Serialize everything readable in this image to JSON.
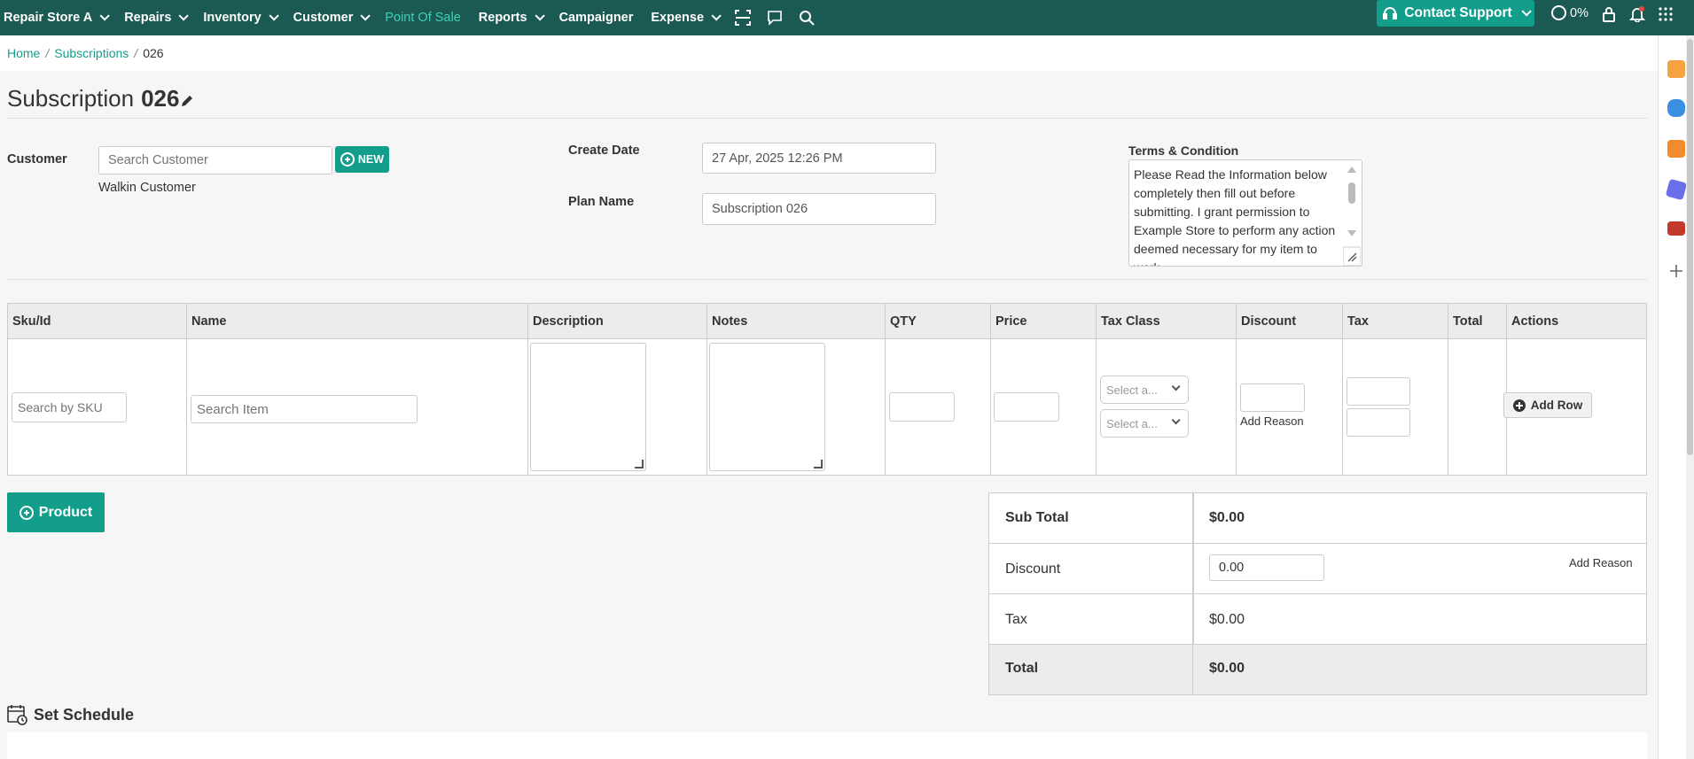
{
  "nav": {
    "store": "Repair Store A",
    "items": [
      "Repairs",
      "Inventory",
      "Customer"
    ],
    "pos": "Point Of Sale",
    "items2": [
      "Reports"
    ],
    "campaigner": "Campaigner",
    "expense": "Expense",
    "support": "Contact Support",
    "progress": "0%"
  },
  "breadcrumb": {
    "home": "Home",
    "subscriptions": "Subscriptions",
    "current": "026"
  },
  "page": {
    "title": "Subscription",
    "number": "026"
  },
  "form": {
    "customer_label": "Customer",
    "customer_placeholder": "Search Customer",
    "new_label": "NEW",
    "customer_value": "Walkin Customer",
    "create_date_label": "Create Date",
    "create_date_value": "27 Apr,  2025 12:26 PM",
    "plan_name_label": "Plan Name",
    "plan_name_value": "Subscription 026",
    "terms_label": "Terms & Condition",
    "terms_text": "Please Read the Information below completely then fill out before submitting. I grant permission to Example Store to perform any action deemed necessary for my item to work"
  },
  "table": {
    "headers": [
      "Sku/Id",
      "Name",
      "Description",
      "Notes",
      "QTY",
      "Price",
      "Tax Class",
      "Discount",
      "Tax",
      "Total",
      "Actions"
    ],
    "sku_placeholder": "Search by SKU",
    "item_placeholder": "Search Item",
    "select_placeholder": "Select a...",
    "add_reason": "Add Reason",
    "add_row": "Add Row"
  },
  "product_btn": "Product",
  "totals": {
    "subtotal_label": "Sub Total",
    "subtotal_value": "$0.00",
    "discount_label": "Discount",
    "discount_value": "0.00",
    "discount_reason": "Add Reason",
    "tax_label": "Tax",
    "tax_value": "$0.00",
    "total_label": "Total",
    "total_value": "$0.00"
  },
  "schedule": {
    "title": "Set Schedule"
  },
  "colors": {
    "nav_bg": "#1a5a52",
    "accent": "#139e8b",
    "active_nav": "#3fd0b5"
  }
}
